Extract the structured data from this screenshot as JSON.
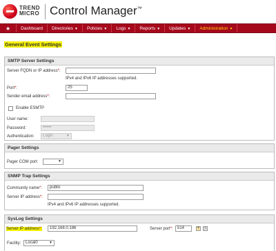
{
  "brand": {
    "logo_line1": "TREND",
    "logo_line2": "MICRO",
    "app_title": "Control Manager",
    "tm": "™"
  },
  "nav": {
    "star": "★",
    "items": [
      {
        "label": "Dashboard"
      },
      {
        "label": "Directories"
      },
      {
        "label": "Policies"
      },
      {
        "label": "Logs"
      },
      {
        "label": "Reports"
      },
      {
        "label": "Updates"
      },
      {
        "label": "Administration"
      }
    ],
    "caret": "▼"
  },
  "page_title": "General Event Settings",
  "smtp": {
    "heading": "SMTP Server Settings",
    "server_label": "Server FQDN or IP address",
    "server_value": "",
    "ip_hint": "IPv4 and IPv6 IP addresses supported.",
    "port_label": "Port",
    "port_value": "25",
    "sender_label": "Sender email address",
    "sender_value": "",
    "esmtp_label": "Enable ESMTP",
    "username_label": "User name:",
    "password_label": "Password:",
    "password_value": "••••••",
    "auth_label": "Authentication:",
    "auth_value": "Login"
  },
  "pager": {
    "heading": "Pager Settings",
    "com_label": "Pager COM port:",
    "com_value": ""
  },
  "snmp": {
    "heading": "SNMP Trap Settings",
    "community_label": "Community name",
    "community_value": "public",
    "server_label": "Server IP address",
    "server_value": "",
    "ip_hint": "IPv4 and IPv6 IP addresses supported."
  },
  "syslog": {
    "heading": "SysLog Settings",
    "server_label": "Server IP address",
    "server_value": "192.168.0.186",
    "port_label": "Server port",
    "port_value": "514",
    "plus": "+",
    "minus": "−",
    "facility_label": "Facility:",
    "facility_value": "Local0"
  },
  "required_mark": "*",
  "colon": ":"
}
